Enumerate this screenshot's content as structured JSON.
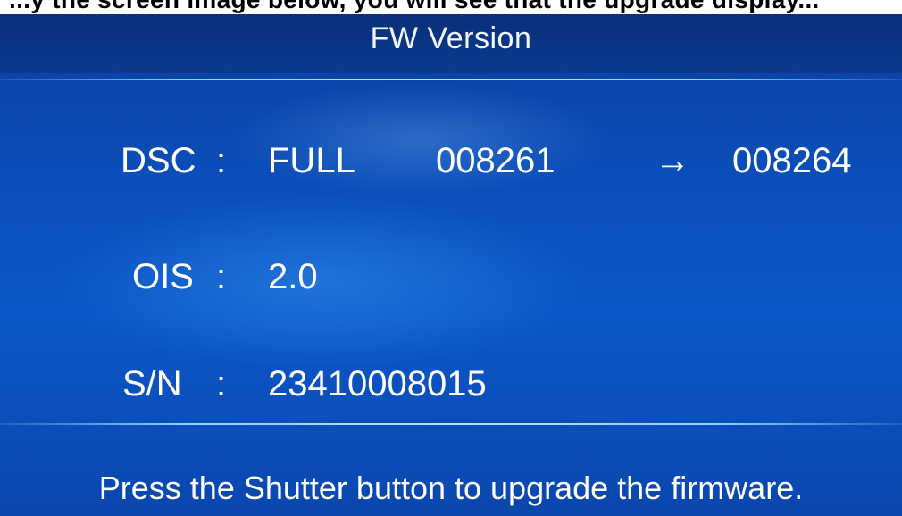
{
  "caption": "...y the screen image below, you will see that the upgrade display...",
  "title": "FW Version",
  "rows": {
    "dsc": {
      "label": "DSC",
      "colon": ":",
      "type": "FULL",
      "current": "008261",
      "arrow": "→",
      "new": "008264"
    },
    "ois": {
      "label": "OIS",
      "colon": ":",
      "value": "2.0"
    },
    "sn": {
      "label": "S/N",
      "colon": ":",
      "value": "23410008015"
    }
  },
  "footer": "Press the Shutter button to upgrade the firmware."
}
